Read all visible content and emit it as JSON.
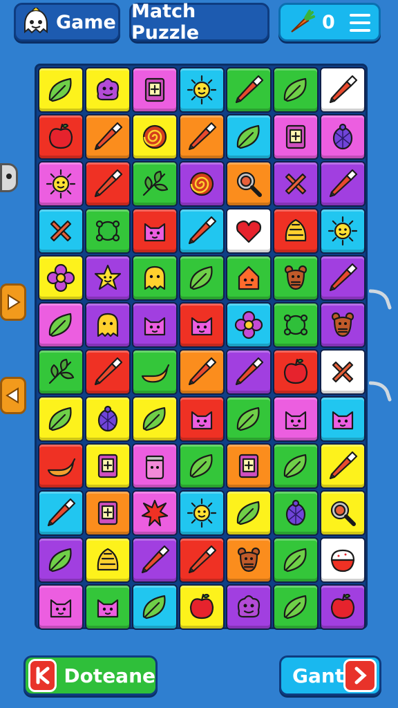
{
  "header": {
    "game_label": "Game",
    "title": "Match Puzzle",
    "score": "0",
    "score_icon": "carrot-icon",
    "menu_icon": "hamburger-menu-icon"
  },
  "footer": {
    "left_button_label": "Doteane",
    "left_button_icon": "back-k-icon",
    "right_button_label": "Gant",
    "right_button_icon": "chevron-right-icon"
  },
  "board": {
    "columns": 7,
    "rows": 12,
    "tiles": [
      [
        [
          "yellow",
          "leaf"
        ],
        [
          "yellow",
          "monster"
        ],
        [
          "pink",
          "card"
        ],
        [
          "cyan",
          "sun"
        ],
        [
          "green",
          "crayon"
        ],
        [
          "green",
          "leaf"
        ],
        [
          "white",
          "crayon"
        ]
      ],
      [
        [
          "red",
          "apple"
        ],
        [
          "orange",
          "crayon"
        ],
        [
          "yellow",
          "swirl"
        ],
        [
          "orange",
          "crayon"
        ],
        [
          "cyan",
          "leaf"
        ],
        [
          "pink",
          "card"
        ],
        [
          "pink",
          "beetle"
        ]
      ],
      [
        [
          "pink",
          "sun"
        ],
        [
          "red",
          "crayon"
        ],
        [
          "green",
          "branch"
        ],
        [
          "purple",
          "swirl"
        ],
        [
          "orange",
          "magnifier"
        ],
        [
          "purple",
          "cross"
        ],
        [
          "purple",
          "crayon"
        ]
      ],
      [
        [
          "cyan",
          "cross"
        ],
        [
          "green",
          "blob"
        ],
        [
          "red",
          "cat"
        ],
        [
          "cyan",
          "crayon"
        ],
        [
          "white",
          "heart"
        ],
        [
          "red",
          "shell"
        ],
        [
          "cyan",
          "sun"
        ]
      ],
      [
        [
          "yellow",
          "flower"
        ],
        [
          "purple",
          "star-face"
        ],
        [
          "green",
          "ghost"
        ],
        [
          "green",
          "leaf"
        ],
        [
          "green",
          "house"
        ],
        [
          "green",
          "bear"
        ],
        [
          "purple",
          "crayon"
        ]
      ],
      [
        [
          "pink",
          "leaf"
        ],
        [
          "purple",
          "ghost"
        ],
        [
          "purple",
          "cat"
        ],
        [
          "red",
          "cat"
        ],
        [
          "cyan",
          "flower"
        ],
        [
          "green",
          "blob"
        ],
        [
          "purple",
          "bear"
        ]
      ],
      [
        [
          "green",
          "branch"
        ],
        [
          "red",
          "crayon"
        ],
        [
          "green",
          "banana"
        ],
        [
          "orange",
          "crayon"
        ],
        [
          "purple",
          "crayon"
        ],
        [
          "red",
          "apple"
        ],
        [
          "white",
          "cross"
        ]
      ],
      [
        [
          "yellow",
          "leaf"
        ],
        [
          "yellow",
          "beetle"
        ],
        [
          "yellow",
          "leaf"
        ],
        [
          "red",
          "cat"
        ],
        [
          "green",
          "leaf"
        ],
        [
          "pink",
          "cat"
        ],
        [
          "cyan",
          "cat"
        ]
      ],
      [
        [
          "red",
          "banana"
        ],
        [
          "yellow",
          "card"
        ],
        [
          "pink",
          "jar"
        ],
        [
          "green",
          "leaf"
        ],
        [
          "orange",
          "card"
        ],
        [
          "green",
          "leaf"
        ],
        [
          "yellow",
          "crayon"
        ]
      ],
      [
        [
          "cyan",
          "crayon"
        ],
        [
          "orange",
          "card"
        ],
        [
          "pink",
          "splat"
        ],
        [
          "cyan",
          "sun"
        ],
        [
          "yellow",
          "leaf"
        ],
        [
          "green",
          "beetle"
        ],
        [
          "yellow",
          "magnifier"
        ]
      ],
      [
        [
          "purple",
          "leaf"
        ],
        [
          "yellow",
          "shell"
        ],
        [
          "purple",
          "crayon"
        ],
        [
          "red",
          "crayon"
        ],
        [
          "orange",
          "bear"
        ],
        [
          "green",
          "leaf"
        ],
        [
          "white",
          "cake"
        ]
      ],
      [
        [
          "pink",
          "cat"
        ],
        [
          "green",
          "cat"
        ],
        [
          "cyan",
          "leaf"
        ],
        [
          "yellow",
          "apple"
        ],
        [
          "purple",
          "monster"
        ],
        [
          "green",
          "leaf"
        ],
        [
          "purple",
          "apple"
        ]
      ]
    ]
  },
  "palette": {
    "yellow": "#fdf21c",
    "pink": "#ec5ee0",
    "cyan": "#21c6f0",
    "green": "#34c63a",
    "white": "#ffffff",
    "red": "#ef3124",
    "orange": "#fb8d1d",
    "purple": "#a13fe0"
  },
  "icon_colors": {
    "leaf": "#6fcf48",
    "monster": "#b34bd6",
    "card": "#cf4fbf",
    "sun": "#ffe033",
    "crayon": "#e84a2e",
    "apple": "#e6232d",
    "swirl": "#d43e1c",
    "beetle": "#7044d8",
    "branch": "#4aa83a",
    "magnifier": "#c8c8c8",
    "cross": "#e8603a",
    "blob": "#2fbf3a",
    "cat": "#ec5ee0",
    "heart": "#e6232d",
    "shell": "#ffd12e",
    "flower": "#c44bd6",
    "star-face": "#ffe033",
    "ghost": "#ffd12e",
    "house": "#ff6b2d",
    "bear": "#c05a2a",
    "banana": "#f2a12e",
    "jar": "#f28ad8",
    "splat": "#ef3124",
    "cake": "#ef3124"
  }
}
